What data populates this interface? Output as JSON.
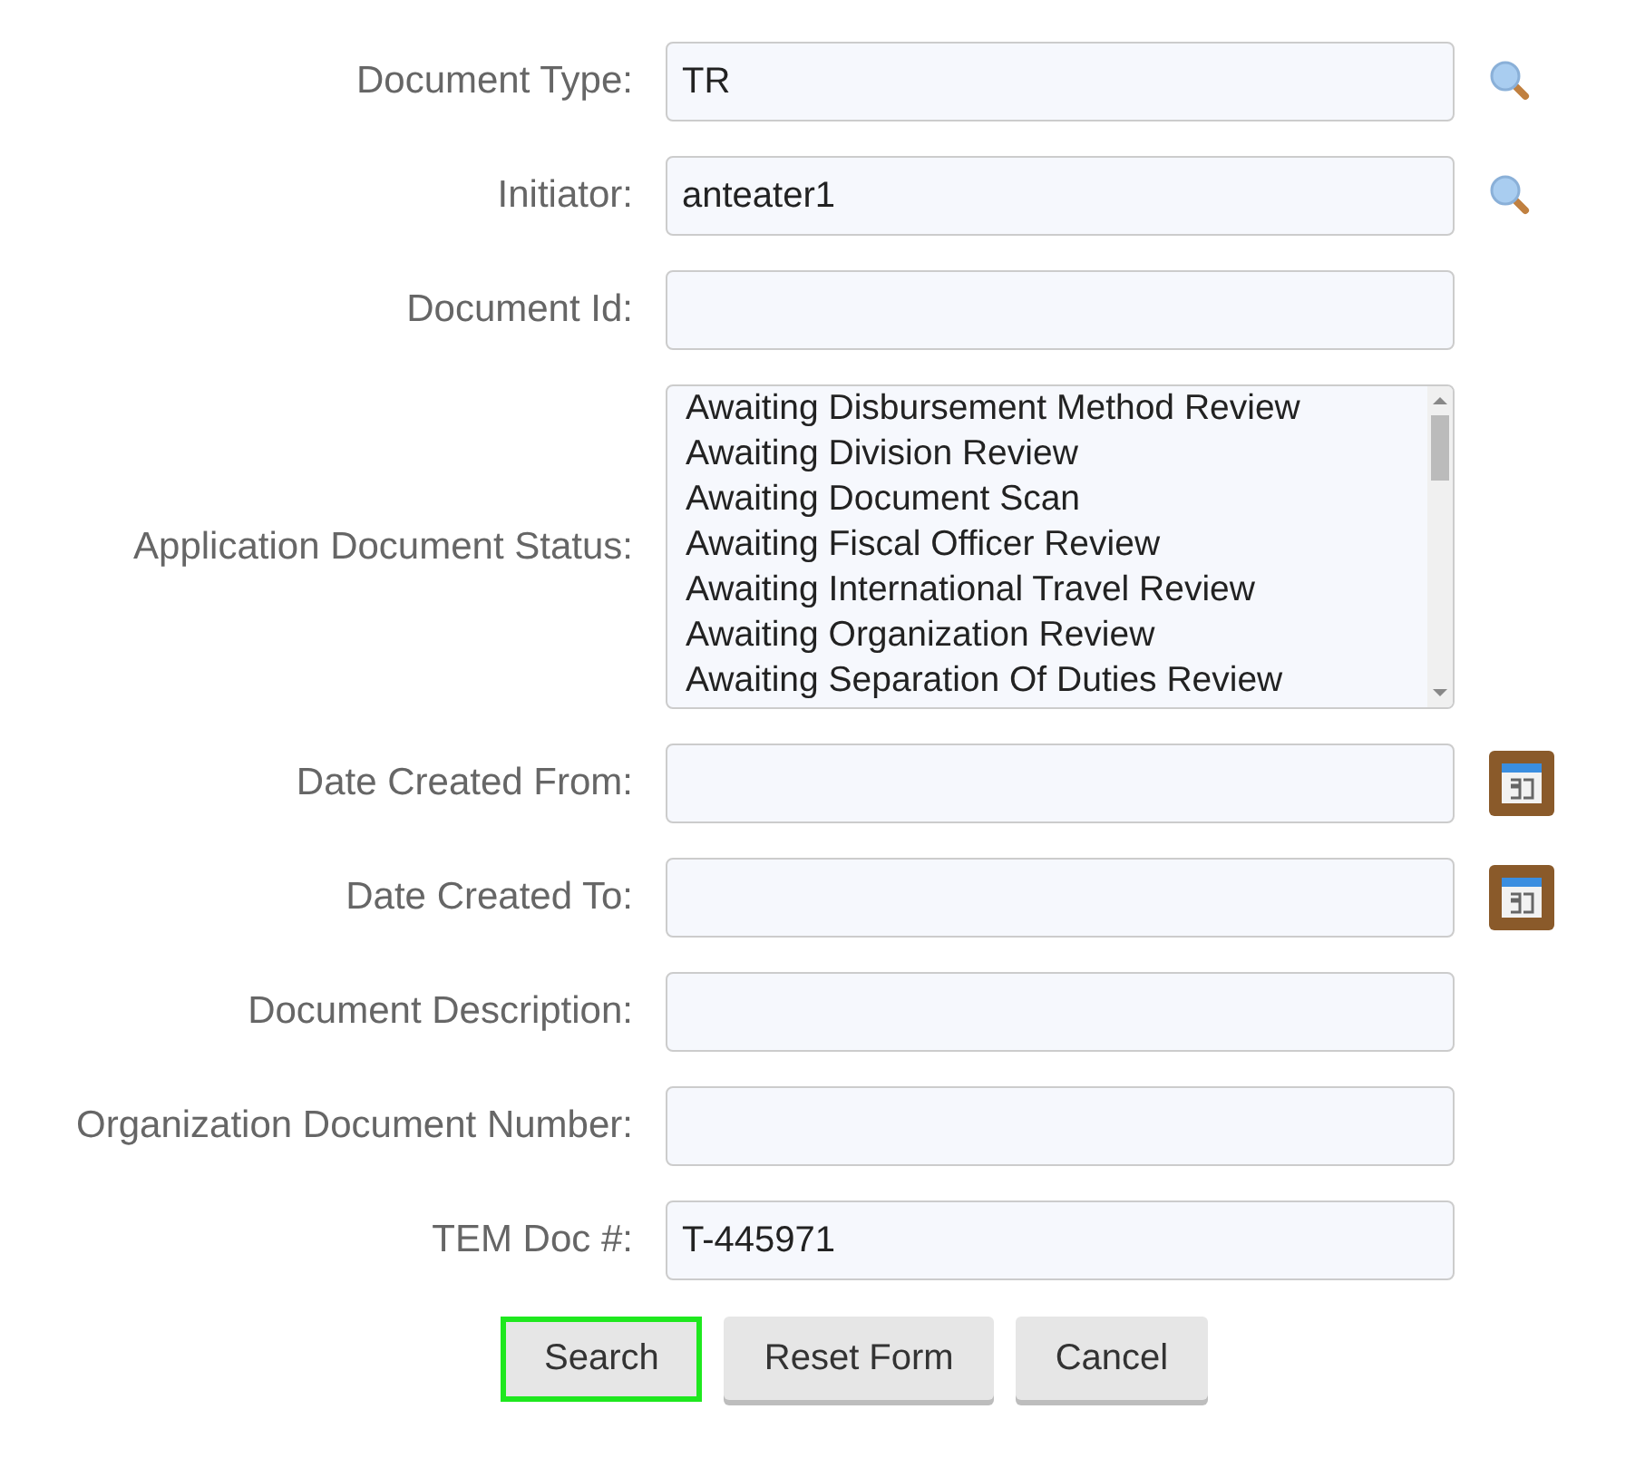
{
  "fields": [
    {
      "label": "Document Type:",
      "kind": "text",
      "value": "TR",
      "lookup": true
    },
    {
      "label": "Initiator:",
      "kind": "text",
      "value": "anteater1",
      "lookup": true
    },
    {
      "label": "Document Id:",
      "kind": "text"
    },
    {
      "label": "Application Document Status:",
      "kind": "listbox",
      "options": [
        {
          "label": "Awaiting Disbursement Method Review",
          "selected": false
        },
        {
          "label": "Awaiting Division Review",
          "selected": false
        },
        {
          "label": "Awaiting Document Scan",
          "selected": false
        },
        {
          "label": "Awaiting Fiscal Officer Review",
          "selected": false
        },
        {
          "label": "Awaiting International Travel Review",
          "selected": false
        },
        {
          "label": "Awaiting Organization Review",
          "selected": false
        },
        {
          "label": "Awaiting Separation Of Duties Review",
          "selected": false
        }
      ]
    },
    {
      "label": "Date Created From:",
      "kind": "text",
      "calendar": true
    },
    {
      "label": "Date Created To:",
      "kind": "text",
      "calendar": true
    },
    {
      "label": "Document Description:",
      "kind": "text"
    },
    {
      "label": "Organization Document Number:",
      "kind": "text"
    },
    {
      "label": "TEM Doc #:",
      "kind": "text",
      "value": "T-445971"
    }
  ],
  "buttons": [
    {
      "label": "Search",
      "focused": true
    },
    {
      "label": "Reset Form",
      "focused": false
    },
    {
      "label": "Cancel",
      "focused": false
    }
  ]
}
